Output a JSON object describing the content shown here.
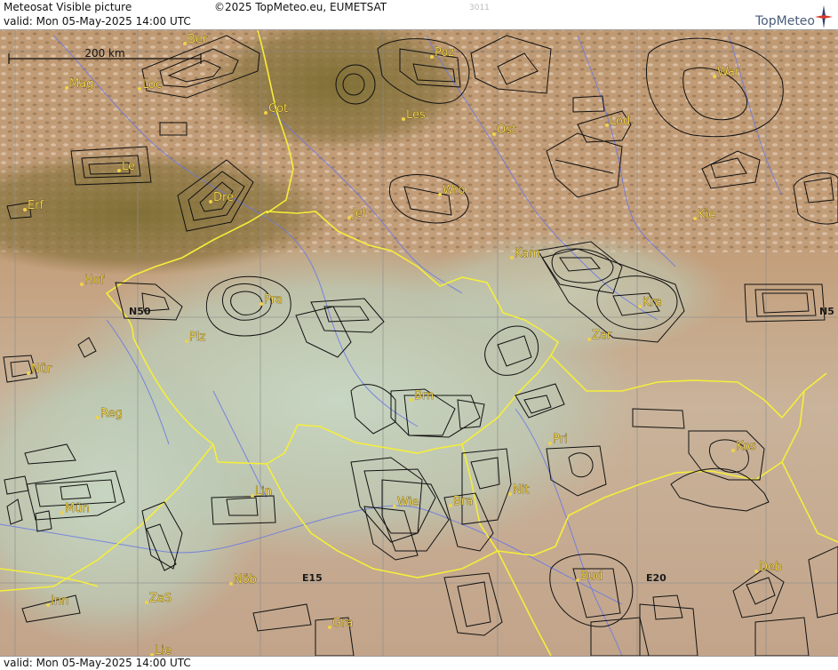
{
  "header": {
    "title": "Meteosat Visible picture",
    "valid": "valid:  Mon  05-May-2025  14:00 UTC",
    "copyright": "©2025 TopMeteo.eu, EUMETSAT",
    "code": "3011",
    "logo_text": "TopMeteo"
  },
  "footer": {
    "valid": "valid:  Mon  05-May-2025  14:00 UTC"
  },
  "scale_bar": {
    "label": "200 km"
  },
  "grid_labels": {
    "n50_left": "N50",
    "n50_right": "N5",
    "e15": "E15",
    "e20": "E20"
  },
  "cities": [
    {
      "id": "ber",
      "name": "Ber"
    },
    {
      "id": "poz",
      "name": "Poz"
    },
    {
      "id": "war",
      "name": "War"
    },
    {
      "id": "mag",
      "name": "Mag"
    },
    {
      "id": "loc",
      "name": "Loc"
    },
    {
      "id": "cot",
      "name": "Cot"
    },
    {
      "id": "les",
      "name": "Les"
    },
    {
      "id": "ost",
      "name": "Ost"
    },
    {
      "id": "lod",
      "name": "Lod"
    },
    {
      "id": "le",
      "name": "Le"
    },
    {
      "id": "dre",
      "name": "Dre"
    },
    {
      "id": "wro",
      "name": "Wro"
    },
    {
      "id": "erf",
      "name": "Erf"
    },
    {
      "id": "jel",
      "name": "Jel"
    },
    {
      "id": "kie",
      "name": "Kie"
    },
    {
      "id": "kam",
      "name": "Kam"
    },
    {
      "id": "hof",
      "name": "Hof"
    },
    {
      "id": "pra",
      "name": "Pra"
    },
    {
      "id": "kra",
      "name": "Kra"
    },
    {
      "id": "plz",
      "name": "Plz"
    },
    {
      "id": "zar",
      "name": "Zar"
    },
    {
      "id": "nur",
      "name": "Nür"
    },
    {
      "id": "brn",
      "name": "Brn"
    },
    {
      "id": "reg",
      "name": "Reg"
    },
    {
      "id": "pri",
      "name": "Pri"
    },
    {
      "id": "kos",
      "name": "Kos"
    },
    {
      "id": "lin",
      "name": "Lin"
    },
    {
      "id": "nit",
      "name": "Nit"
    },
    {
      "id": "wie",
      "name": "Wie"
    },
    {
      "id": "bra",
      "name": "Bra"
    },
    {
      "id": "mun",
      "name": "Mün"
    },
    {
      "id": "bud",
      "name": "Bud"
    },
    {
      "id": "deb",
      "name": "Deb"
    },
    {
      "id": "nob",
      "name": "Nöb"
    },
    {
      "id": "inn",
      "name": "Inn"
    },
    {
      "id": "zas",
      "name": "ZaS"
    },
    {
      "id": "gra",
      "name": "Gra"
    },
    {
      "id": "lie",
      "name": "Lie"
    }
  ],
  "colors": {
    "border_yellow": "#f5ee3a",
    "river_blue": "#6a78e6",
    "grid": "#8d8d8d",
    "label_yellow": "#f0d34a",
    "forecast_outline": "#111111"
  }
}
